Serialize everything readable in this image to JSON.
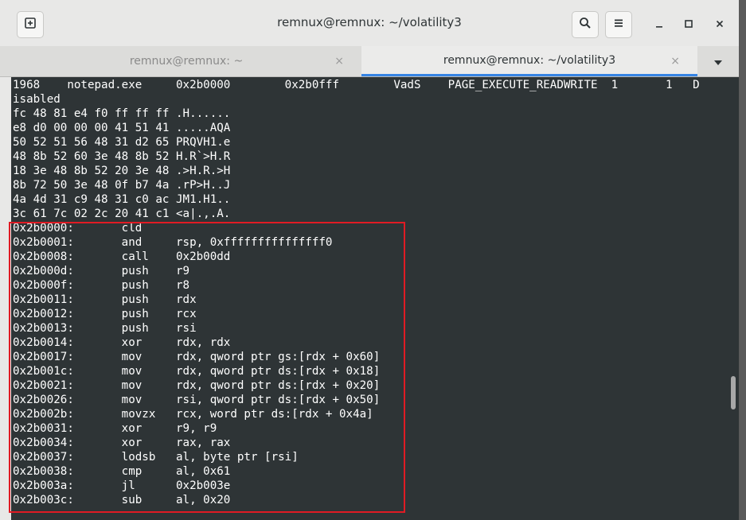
{
  "window": {
    "title": "remnux@remnux: ~/volatility3"
  },
  "tabs": [
    {
      "label": "remnux@remnux: ~",
      "close": "×",
      "active": false
    },
    {
      "label": "remnux@remnux: ~/volatility3",
      "close": "×",
      "active": true
    }
  ],
  "icons": {
    "new_tab": "new-tab-icon",
    "search": "search-icon",
    "menu": "hamburger-menu-icon",
    "minimize": "minimize-icon",
    "maximize": "maximize-icon",
    "close": "close-icon",
    "tab_dropdown": "chevron-down-icon"
  },
  "colors": {
    "terminal_bg": "#2e3436",
    "terminal_fg": "#ffffff",
    "highlight_box": "#e01b24",
    "active_tab_indicator": "#3584e4"
  },
  "terminal": {
    "lines": [
      "1968    notepad.exe     0x2b0000        0x2b0fff        VadS    PAGE_EXECUTE_READWRITE  1       1   D",
      "isabled",
      "fc 48 81 e4 f0 ff ff ff .H......",
      "e8 d0 00 00 00 41 51 41 .....AQA",
      "50 52 51 56 48 31 d2 65 PRQVH1.e",
      "48 8b 52 60 3e 48 8b 52 H.R`>H.R",
      "18 3e 48 8b 52 20 3e 48 .>H.R.>H",
      "8b 72 50 3e 48 0f b7 4a .rP>H..J",
      "4a 4d 31 c9 48 31 c0 ac JM1.H1..",
      "3c 61 7c 02 2c 20 41 c1 <a|.,.A.",
      "0x2b0000:       cld",
      "0x2b0001:       and     rsp, 0xfffffffffffffff0",
      "0x2b0008:       call    0x2b00dd",
      "0x2b000d:       push    r9",
      "0x2b000f:       push    r8",
      "0x2b0011:       push    rdx",
      "0x2b0012:       push    rcx",
      "0x2b0013:       push    rsi",
      "0x2b0014:       xor     rdx, rdx",
      "0x2b0017:       mov     rdx, qword ptr gs:[rdx + 0x60]",
      "0x2b001c:       mov     rdx, qword ptr ds:[rdx + 0x18]",
      "0x2b0021:       mov     rdx, qword ptr ds:[rdx + 0x20]",
      "0x2b0026:       mov     rsi, qword ptr ds:[rdx + 0x50]",
      "0x2b002b:       movzx   rcx, word ptr ds:[rdx + 0x4a]",
      "0x2b0031:       xor     r9, r9",
      "0x2b0034:       xor     rax, rax",
      "0x2b0037:       lodsb   al, byte ptr [rsi]",
      "0x2b0038:       cmp     al, 0x61",
      "0x2b003a:       jl      0x2b003e",
      "0x2b003c:       sub     al, 0x20"
    ]
  }
}
